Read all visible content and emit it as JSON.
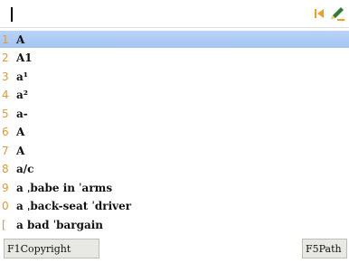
{
  "search": {
    "value": ""
  },
  "toolbar": {
    "first_icon": "first-page-icon",
    "edit_icon": "edit-pencil-icon",
    "accent": "#f0a020"
  },
  "list": {
    "items": [
      {
        "num": "1",
        "word": "A"
      },
      {
        "num": "2",
        "word": "A1"
      },
      {
        "num": "3",
        "word": "a¹"
      },
      {
        "num": "4",
        "word": "a²"
      },
      {
        "num": "5",
        "word": "a-"
      },
      {
        "num": "6",
        "word": "A"
      },
      {
        "num": "7",
        "word": "A"
      },
      {
        "num": "8",
        "word": "a/c"
      },
      {
        "num": "9",
        "word": "a ˌbabe in ˈarms"
      },
      {
        "num": "0",
        "word": "a ˌback-seat ˈdriver"
      },
      {
        "num": "[",
        "word": "a bad ˈbargain"
      }
    ],
    "selected_index": 0
  },
  "statusbar": {
    "copyright_label": "F1Copyright",
    "path_label": "F5Path"
  }
}
